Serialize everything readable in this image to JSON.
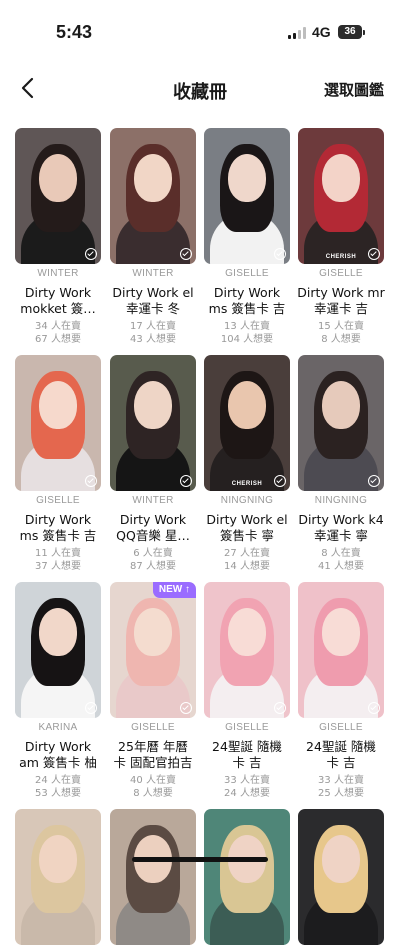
{
  "status_bar": {
    "time": "5:43",
    "network": "4G",
    "battery": "36"
  },
  "nav": {
    "title": "收藏冊",
    "select_label": "選取圖鑑"
  },
  "cards": [
    {
      "artist": "WINTER",
      "name1": "Dirty Work",
      "name2": "mokket 簽…",
      "selling": "34 人在賣",
      "wanting": "67 人想要",
      "bg": "#5f5656",
      "skin": "#e9c9b8",
      "hair": "#241b1a",
      "cloth": "#1b1b1b",
      "cherish": "",
      "badge": ""
    },
    {
      "artist": "WINTER",
      "name1": "Dirty Work el",
      "name2": "幸運卡 冬",
      "selling": "17 人在賣",
      "wanting": "43 人想要",
      "bg": "#8c7068",
      "skin": "#f1d6c6",
      "hair": "#5a2e2a",
      "cloth": "#3a2d2f",
      "cherish": "",
      "badge": ""
    },
    {
      "artist": "GISELLE",
      "name1": "Dirty Work",
      "name2": "ms 簽售卡 吉",
      "selling": "13 人在賣",
      "wanting": "104 人想要",
      "bg": "#7a7e84",
      "skin": "#efd7cb",
      "hair": "#1a1617",
      "cloth": "#f2f2f2",
      "cherish": "",
      "badge": ""
    },
    {
      "artist": "GISELLE",
      "name1": "Dirty Work mr",
      "name2": "幸運卡 吉",
      "selling": "15 人在賣",
      "wanting": "8 人想要",
      "bg": "#6d3a3c",
      "skin": "#f3d3c8",
      "hair": "#b32935",
      "cloth": "#2c2424",
      "cherish": "CHERISH",
      "badge": ""
    },
    {
      "artist": "GISELLE",
      "name1": "Dirty Work",
      "name2": "ms 簽售卡 吉",
      "selling": "11 人在賣",
      "wanting": "37 人想要",
      "bg": "#c9b7ae",
      "skin": "#f6d9cc",
      "hair": "#e4674e",
      "cloth": "#e6dfe0",
      "cherish": "",
      "badge": ""
    },
    {
      "artist": "WINTER",
      "name1": "Dirty Work",
      "name2": "QQ音樂 星…",
      "selling": "6 人在賣",
      "wanting": "87 人想要",
      "bg": "#585b4d",
      "skin": "#eed5c6",
      "hair": "#2e2424",
      "cloth": "#151515",
      "cherish": "",
      "badge": ""
    },
    {
      "artist": "NINGNING",
      "name1": "Dirty Work el",
      "name2": "簽售卡 寧",
      "selling": "27 人在賣",
      "wanting": "14 人想要",
      "bg": "#4a3e3b",
      "skin": "#e9c6ae",
      "hair": "#1d1615",
      "cloth": "#252020",
      "cherish": "CHERISH",
      "badge": ""
    },
    {
      "artist": "NINGNING",
      "name1": "Dirty Work k4",
      "name2": "幸運卡 寧",
      "selling": "8 人在賣",
      "wanting": "41 人想要",
      "bg": "#6a6567",
      "skin": "#e6cabb",
      "hair": "#2b2221",
      "cloth": "#4d4b52",
      "cherish": "",
      "badge": ""
    },
    {
      "artist": "KARINA",
      "name1": "Dirty Work",
      "name2": "am 簽售卡 柚",
      "selling": "24 人在賣",
      "wanting": "53 人想要",
      "bg": "#cfd4d8",
      "skin": "#f1d7c9",
      "hair": "#161314",
      "cloth": "#f5f5f5",
      "cherish": "",
      "badge": ""
    },
    {
      "artist": "GISELLE",
      "name1": "25年曆 年曆",
      "name2": "卡 固配官拍吉",
      "selling": "40 人在賣",
      "wanting": "8 人想要",
      "bg": "#e6d6cf",
      "skin": "#f4dccf",
      "hair": "#efb6b0",
      "cloth": "#e9c9c9",
      "cherish": "",
      "badge": "NEW ↑"
    },
    {
      "artist": "GISELLE",
      "name1": "24聖誕 隨機",
      "name2": "卡 吉",
      "selling": "33 人在賣",
      "wanting": "24 人想要",
      "bg": "#efc4cb",
      "skin": "#f8dcd6",
      "hair": "#f1a3b2",
      "cloth": "#f4eef0",
      "cherish": "",
      "badge": ""
    },
    {
      "artist": "GISELLE",
      "name1": "24聖誕 隨機",
      "name2": "卡 吉",
      "selling": "33 人在賣",
      "wanting": "25 人想要",
      "bg": "#efc1c9",
      "skin": "#f8dcd6",
      "hair": "#ef9cae",
      "cloth": "#f4eef0",
      "cherish": "",
      "badge": ""
    },
    {
      "artist": "",
      "name1": "",
      "name2": "",
      "selling": "",
      "wanting": "",
      "bg": "#d8c7b8",
      "skin": "#f0d4c2",
      "hair": "#dcc69f",
      "cloth": "#c9b9aa",
      "cherish": "",
      "badge": ""
    },
    {
      "artist": "",
      "name1": "",
      "name2": "",
      "selling": "",
      "wanting": "",
      "bg": "#b9a89a",
      "skin": "#ecd0bf",
      "hair": "#5b4b43",
      "cloth": "#8f8a86",
      "cherish": "",
      "badge": ""
    },
    {
      "artist": "",
      "name1": "",
      "name2": "",
      "selling": "",
      "wanting": "",
      "bg": "#4f8678",
      "skin": "#efd3c5",
      "hair": "#d9c694",
      "cloth": "#3c5d55",
      "cherish": "",
      "badge": ""
    },
    {
      "artist": "",
      "name1": "",
      "name2": "",
      "selling": "",
      "wanting": "",
      "bg": "#2b2b2d",
      "skin": "#efd3c5",
      "hair": "#e7c78b",
      "cloth": "#1c1c1e",
      "cherish": "",
      "badge": ""
    }
  ]
}
